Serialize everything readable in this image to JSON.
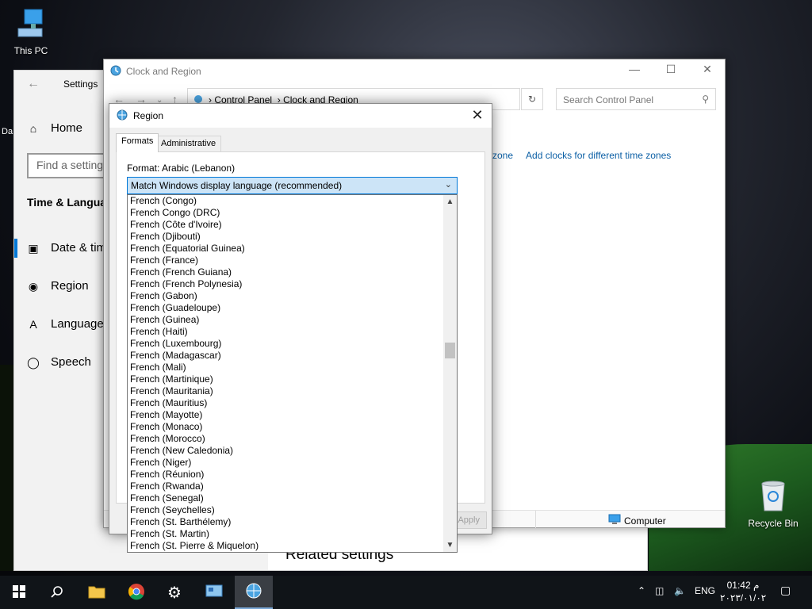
{
  "desktop": {
    "icons": [
      {
        "label": "This PC",
        "icon": "this-pc-icon"
      },
      {
        "label": "Recycle Bin",
        "icon": "recycle-bin-icon"
      }
    ],
    "partial_label": "Da"
  },
  "settings": {
    "title": "Settings",
    "home": "Home",
    "search_placeholder": "Find a setting",
    "section": "Time & Language",
    "nav": [
      {
        "label": "Date & time",
        "icon": "calendar-clock-icon"
      },
      {
        "label": "Region",
        "icon": "globe-icon"
      },
      {
        "label": "Language",
        "icon": "language-icon"
      },
      {
        "label": "Speech",
        "icon": "microphone-icon"
      }
    ],
    "related": "Related settings"
  },
  "control_panel": {
    "title": "Clock and Region",
    "breadcrumb": [
      "Control Panel",
      "Clock and Region"
    ],
    "search_placeholder": "Search Control Panel",
    "links": {
      "tz_fragment": "zone",
      "add_clocks": "Add clocks for different time zones"
    },
    "status": "Computer"
  },
  "region_dialog": {
    "title": "Region",
    "tabs": [
      "Formats",
      "Administrative"
    ],
    "format_label": "Format: Arabic (Lebanon)",
    "selected": "Match Windows display language (recommended)",
    "apply_label": "Apply",
    "options": [
      "French (Congo)",
      "French Congo (DRC)",
      "French (Côte d'Ivoire)",
      "French (Djibouti)",
      "French (Equatorial Guinea)",
      "French (France)",
      "French (French Guiana)",
      "French (French Polynesia)",
      "French (Gabon)",
      "French (Guadeloupe)",
      "French (Guinea)",
      "French (Haiti)",
      "French (Luxembourg)",
      "French (Madagascar)",
      "French (Mali)",
      "French (Martinique)",
      "French (Mauritania)",
      "French (Mauritius)",
      "French (Mayotte)",
      "French (Monaco)",
      "French (Morocco)",
      "French (New Caledonia)",
      "French (Niger)",
      "French (Réunion)",
      "French (Rwanda)",
      "French (Senegal)",
      "French (Seychelles)",
      "French (St. Barthélemy)",
      "French (St. Martin)",
      "French (St. Pierre & Miquelon)"
    ]
  },
  "taskbar": {
    "language": "ENG",
    "time": "01:42 م",
    "date": "٢٠٢٣/٠١/٠٢",
    "apps": [
      "start-icon",
      "search-icon",
      "file-explorer-icon",
      "chrome-icon",
      "settings-gear-icon",
      "control-panel-icon",
      "region-icon"
    ]
  }
}
